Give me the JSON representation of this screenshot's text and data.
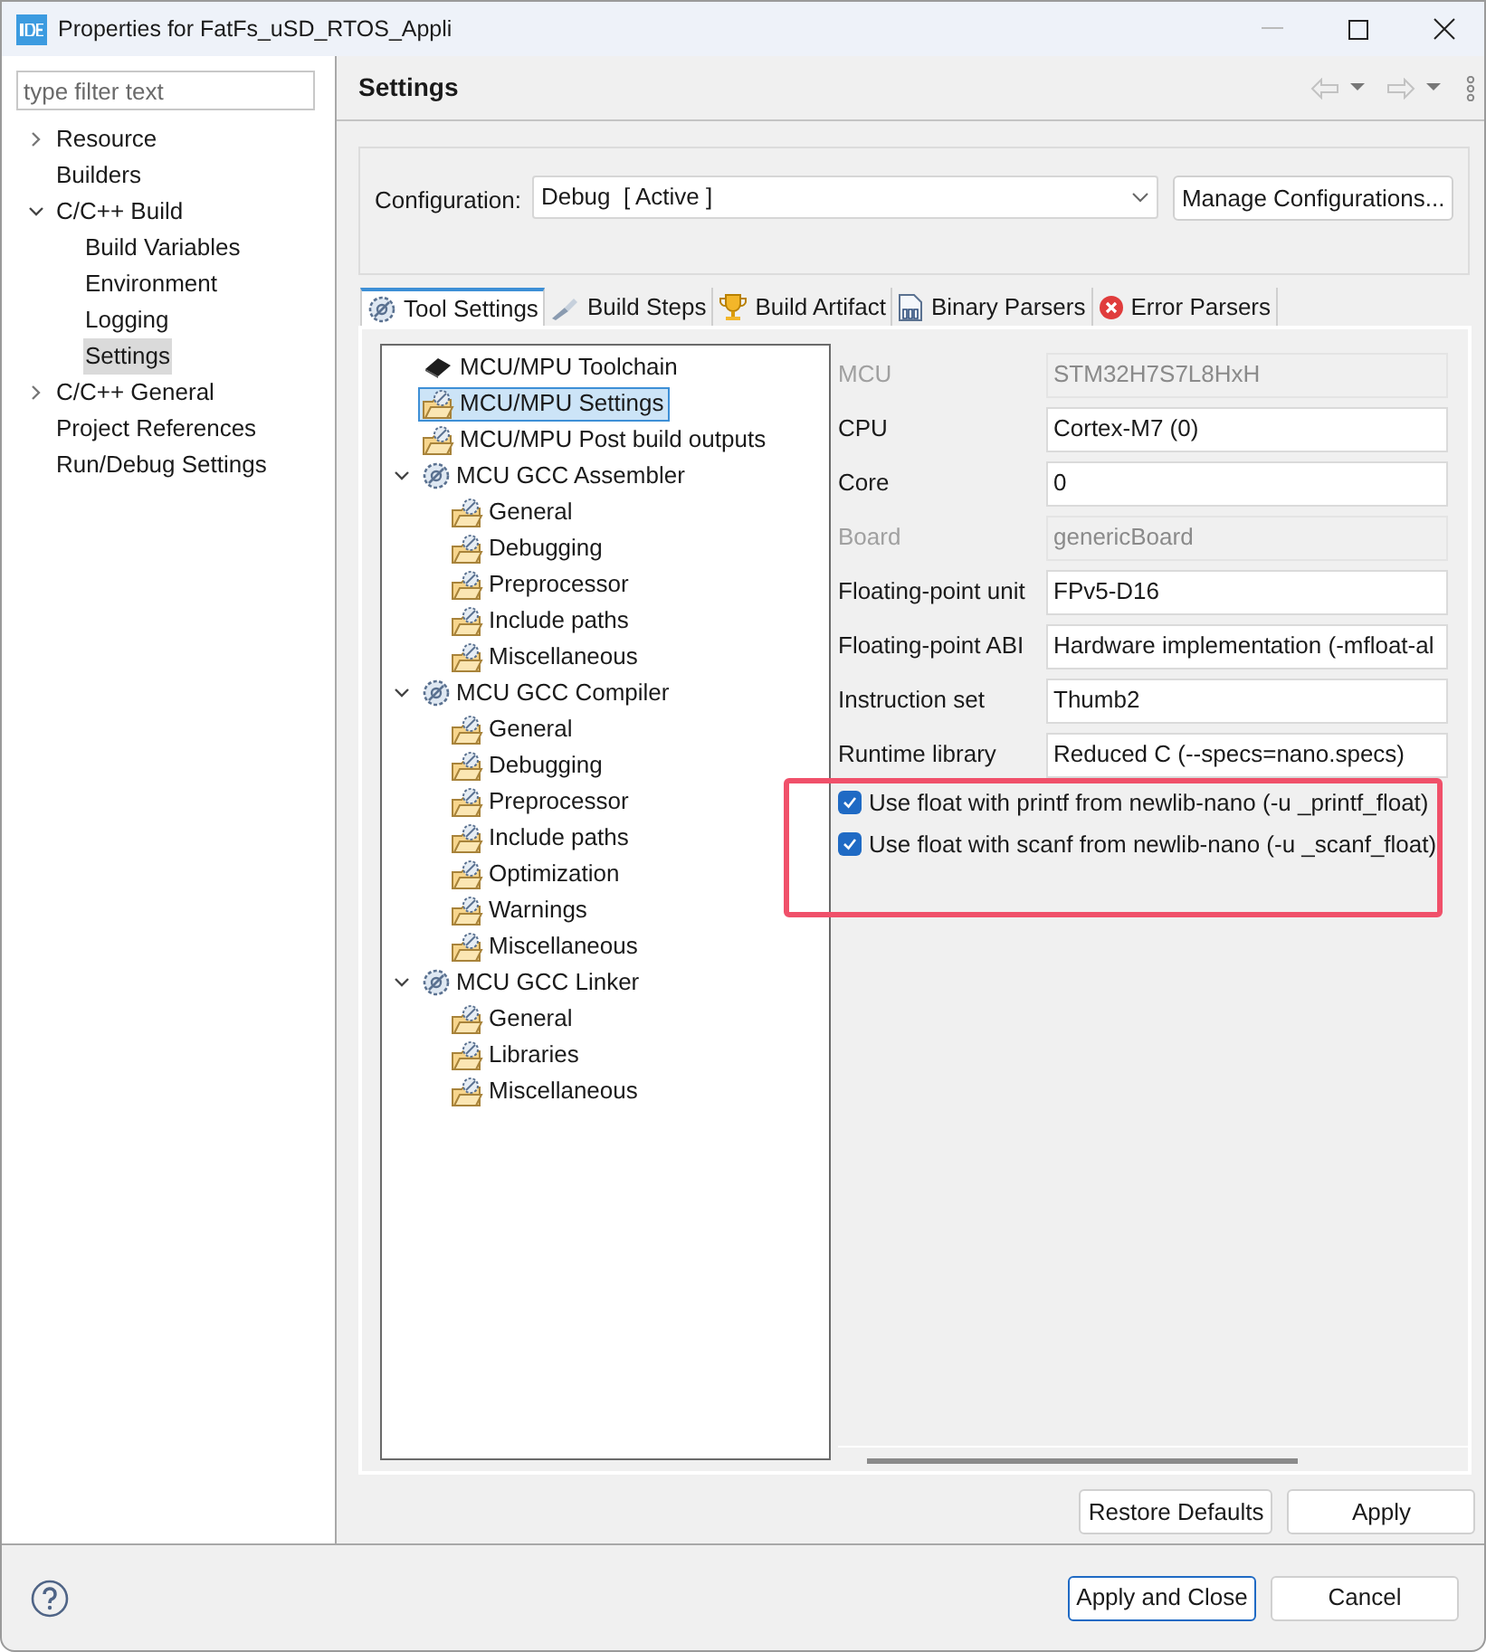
{
  "window": {
    "title": "Properties for FatFs_uSD_RTOS_Appli"
  },
  "sidebar": {
    "filter": {
      "placeholder": "type filter text"
    },
    "items": [
      {
        "label": "Resource",
        "expanded": false,
        "selected": false
      },
      {
        "label": "Builders",
        "selected": false
      },
      {
        "label": "C/C++ Build",
        "expanded": true,
        "selected": false,
        "children": [
          {
            "label": "Build Variables",
            "selected": false
          },
          {
            "label": "Environment",
            "selected": false
          },
          {
            "label": "Logging",
            "selected": false
          },
          {
            "label": "Settings",
            "selected": true
          }
        ]
      },
      {
        "label": "C/C++ General",
        "expanded": false,
        "selected": false
      },
      {
        "label": "Project References",
        "selected": false
      },
      {
        "label": "Run/Debug Settings",
        "selected": false
      }
    ]
  },
  "page": {
    "title": "Settings",
    "configuration": {
      "label": "Configuration:",
      "value": "Debug  [ Active ]",
      "button": "Manage Configurations..."
    },
    "tabs": [
      {
        "label": "Tool Settings",
        "selected": true
      },
      {
        "label": "Build Steps",
        "selected": false
      },
      {
        "label": "Build Artifact",
        "selected": false
      },
      {
        "label": "Binary Parsers",
        "selected": false
      },
      {
        "label": "Error Parsers",
        "selected": false
      }
    ],
    "tool_tree": [
      {
        "label": "MCU/MPU Toolchain",
        "kind": "chip",
        "selected": false
      },
      {
        "label": "MCU/MPU Settings",
        "kind": "page",
        "selected": true
      },
      {
        "label": "MCU/MPU Post build outputs",
        "kind": "page",
        "selected": false
      },
      {
        "label": "MCU GCC Assembler",
        "kind": "tool",
        "expanded": true,
        "selected": false,
        "children": [
          {
            "label": "General",
            "kind": "page",
            "selected": false
          },
          {
            "label": "Debugging",
            "kind": "page",
            "selected": false
          },
          {
            "label": "Preprocessor",
            "kind": "page",
            "selected": false
          },
          {
            "label": "Include paths",
            "kind": "page",
            "selected": false
          },
          {
            "label": "Miscellaneous",
            "kind": "page",
            "selected": false
          }
        ]
      },
      {
        "label": "MCU GCC Compiler",
        "kind": "tool",
        "expanded": true,
        "selected": false,
        "children": [
          {
            "label": "General",
            "kind": "page",
            "selected": false
          },
          {
            "label": "Debugging",
            "kind": "page",
            "selected": false
          },
          {
            "label": "Preprocessor",
            "kind": "page",
            "selected": false
          },
          {
            "label": "Include paths",
            "kind": "page",
            "selected": false
          },
          {
            "label": "Optimization",
            "kind": "page",
            "selected": false
          },
          {
            "label": "Warnings",
            "kind": "page",
            "selected": false
          },
          {
            "label": "Miscellaneous",
            "kind": "page",
            "selected": false
          }
        ]
      },
      {
        "label": "MCU GCC Linker",
        "kind": "tool",
        "expanded": true,
        "selected": false,
        "children": [
          {
            "label": "General",
            "kind": "page",
            "selected": false
          },
          {
            "label": "Libraries",
            "kind": "page",
            "selected": false
          },
          {
            "label": "Miscellaneous",
            "kind": "page",
            "selected": false
          }
        ]
      }
    ],
    "fields": [
      {
        "label": "MCU",
        "value": "STM32H7S7L8HxH",
        "disabled": true
      },
      {
        "label": "CPU",
        "value": "Cortex-M7 (0)",
        "disabled": false
      },
      {
        "label": "Core",
        "value": "0",
        "disabled": false
      },
      {
        "label": "Board",
        "value": "genericBoard",
        "disabled": true
      },
      {
        "label": "Floating-point unit",
        "value": "FPv5-D16",
        "disabled": false
      },
      {
        "label": "Floating-point ABI",
        "value": "Hardware implementation (-mfloat-al",
        "disabled": false
      },
      {
        "label": "Instruction set",
        "value": "Thumb2",
        "disabled": false
      },
      {
        "label": "Runtime library",
        "value": "Reduced C (--specs=nano.specs)",
        "disabled": false
      }
    ],
    "checkboxes": [
      {
        "label": "Use float with printf from newlib-nano (-u _printf_float)",
        "checked": true
      },
      {
        "label": "Use float with scanf from newlib-nano (-u _scanf_float)",
        "checked": true
      }
    ],
    "buttons": [
      "Restore Defaults",
      "Apply"
    ]
  },
  "footer": {
    "buttons": [
      {
        "label": "Apply and Close",
        "default": true
      },
      {
        "label": "Cancel",
        "default": false
      }
    ]
  }
}
